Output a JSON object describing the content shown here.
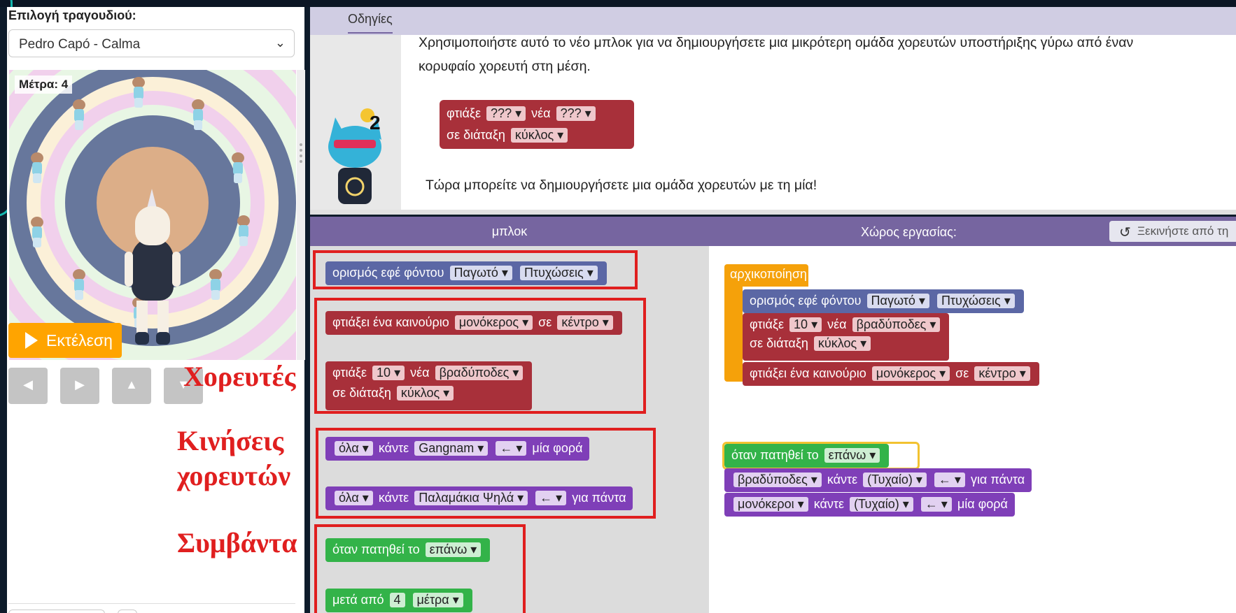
{
  "song": {
    "label": "Επιλογή τραγουδιού:",
    "selected": "Pedro Capó - Calma"
  },
  "stage": {
    "counter": "Μέτρα: 4"
  },
  "controls": {
    "run": "Εκτέλεση",
    "arrows": [
      "◀",
      "▶",
      "▲",
      "▼"
    ]
  },
  "annotations": {
    "dancers": "Χορευτές",
    "moves_line1": "Κινήσεις",
    "moves_line2": "χορευτών",
    "events": "Συμβάντα"
  },
  "instructions": {
    "tab": "Οδηγίες",
    "text1_line1": "Χρησιμοποιήστε αυτό το νέο μπλοκ για να δημιουργήσετε μια μικρότερη ομάδα χορευτών υποστήριξης γύρω από έναν",
    "text1_line2": "κορυφαίο χορευτή στη μέση.",
    "hint_count": "2",
    "example": {
      "make": "φτιάξε",
      "q1": "??? ▾",
      "new": "νέα",
      "q2": "??? ▾",
      "layout": "σε διάταξη",
      "circle": "κύκλος ▾"
    },
    "text2": "Τώρα μπορείτε να δημιουργήσετε μια ομάδα χορευτών με τη μία!"
  },
  "headers": {
    "blocks": "μπλοκ",
    "workspace": "Χώρος εργασίας:",
    "reset": "Ξεκινήστε από τη"
  },
  "toolbox": {
    "bg_effect": {
      "label": "ορισμός εφέ φόντου",
      "v1": "Παγωτό ▾",
      "v2": "Πτυχώσεις ▾"
    },
    "make_one": {
      "label": "φτιάξει ένα καινούριο",
      "who": "μονόκερος ▾",
      "at": "σε",
      "where": "κέντρο ▾"
    },
    "make_many": {
      "make": "φτιάξε",
      "count": "10 ▾",
      "new": "νέα",
      "who": "βραδύποδες ▾",
      "layout": "σε διάταξη",
      "shape": "κύκλος ▾"
    },
    "move_once": {
      "who": "όλα ▾",
      "do": "κάντε",
      "move": "Gangnam ▾",
      "dir": "← ▾",
      "times": "μία φορά"
    },
    "move_forever": {
      "who": "όλα ▾",
      "do": "κάντε",
      "move": "Παλαμάκια Ψηλά ▾",
      "dir": "← ▾",
      "times": "για πάντα"
    },
    "when_pressed": {
      "label": "όταν πατηθεί το",
      "key": "επάνω ▾"
    },
    "after": {
      "label": "μετά από",
      "count": "4",
      "unit": "μέτρα ▾"
    }
  },
  "workspace": {
    "setup": "αρχικοποίηση",
    "bg_effect": {
      "label": "ορισμός εφέ φόντου",
      "v1": "Παγωτό ▾",
      "v2": "Πτυχώσεις ▾"
    },
    "make_many": {
      "make": "φτιάξε",
      "count": "10 ▾",
      "new": "νέα",
      "who": "βραδύποδες ▾",
      "layout": "σε διάταξη",
      "shape": "κύκλος ▾"
    },
    "make_one": {
      "label": "φτιάξει ένα καινούριο",
      "who": "μονόκερος ▾",
      "at": "σε",
      "where": "κέντρο ▾"
    },
    "when_pressed": {
      "label": "όταν πατηθεί το",
      "key": "επάνω ▾"
    },
    "sloths_move": {
      "who": "βραδύποδες ▾",
      "do": "κάντε",
      "move": "(Τυχαίο) ▾",
      "dir": "← ▾",
      "times": "για πάντα"
    },
    "unicorns_move": {
      "who": "μονόκεροι ▾",
      "do": "κάντε",
      "move": "(Τυχαίο) ▾",
      "dir": "← ▾",
      "times": "μία φορά"
    }
  },
  "colors": {
    "run": "#ffa400",
    "header": "#7665a0",
    "annotation": "#e01f1f",
    "blue_block": "#5b67a5",
    "red_block": "#a8303a",
    "purple_block": "#7f3fb8",
    "green_block": "#33b349",
    "orange_block": "#f5a10a"
  }
}
